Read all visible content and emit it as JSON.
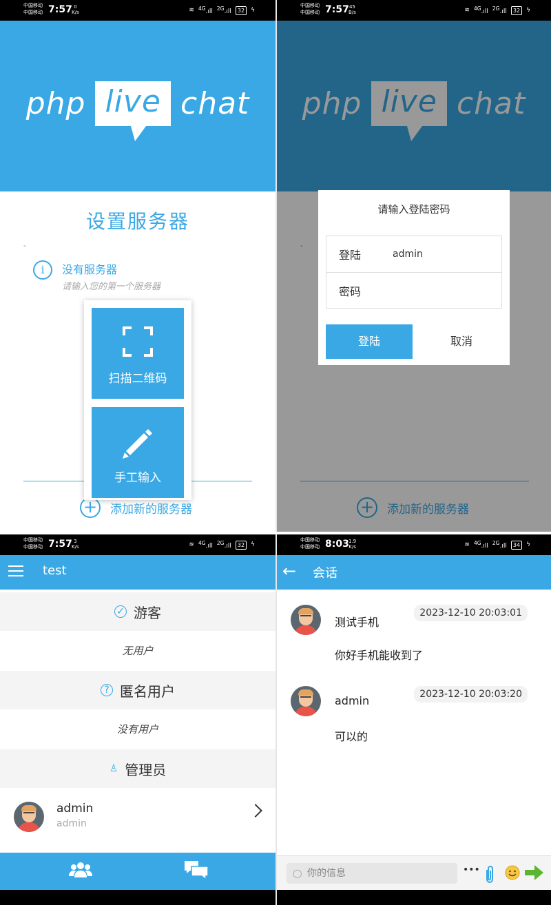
{
  "status_bars": [
    {
      "carrier1": "中国移动",
      "carrier2": "中国移动",
      "time": "7:57",
      "speed_num": "0",
      "speed_unit": "K/s",
      "net1": "4G",
      "net2": "2G",
      "battery": "32"
    },
    {
      "carrier1": "中国移动",
      "carrier2": "中国移动",
      "time": "7:57",
      "speed_num": "45",
      "speed_unit": "B/s",
      "net1": "4G",
      "net2": "2G",
      "battery": "32"
    },
    {
      "carrier1": "中国移动",
      "carrier2": "中国移动",
      "time": "7:57",
      "speed_num": "3",
      "speed_unit": "K/s",
      "net1": "4G",
      "net2": "2G",
      "battery": "32"
    },
    {
      "carrier1": "中国移动",
      "carrier2": "中国移动",
      "time": "8:03",
      "speed_num": "1.9",
      "speed_unit": "K/s",
      "net1": "4G",
      "net2": "2G",
      "battery": "34"
    }
  ],
  "logo": {
    "left": "php",
    "box": "live",
    "right": "chat"
  },
  "setup": {
    "title": "设置服务器",
    "dash": "-",
    "info_icon": "info-icon",
    "no_server": "没有服务器",
    "hint": "请输入您的第一个服务器",
    "add_server": "添加新的服务器"
  },
  "popup": {
    "scan_label": "扫描二维码",
    "manual_label": "手工输入",
    "scan_icon": "qr-scan-icon",
    "edit_icon": "pencil-icon"
  },
  "login_dialog": {
    "title": "请输入登陆密码",
    "login_label": "登陆",
    "login_value": "admin",
    "password_label": "密码",
    "login_button": "登陆",
    "cancel_button": "取消"
  },
  "users_screen": {
    "app_title": "test",
    "sections": [
      {
        "title": "游客",
        "empty": "无用户"
      },
      {
        "title": "匿名用户",
        "empty": "没有用户"
      },
      {
        "title": "管理员"
      }
    ],
    "admin_user": {
      "name": "admin",
      "sub": "admin"
    }
  },
  "chat_screen": {
    "title": "会话",
    "messages": [
      {
        "name": "测试手机",
        "time": "2023-12-10 20:03:01",
        "text": "你好手机能收到了"
      },
      {
        "name": "admin",
        "time": "2023-12-10 20:03:20",
        "text": "可以的"
      }
    ],
    "input_placeholder": "你的信息",
    "more": "•••"
  },
  "colors": {
    "primary": "#3aa8e4",
    "section_bg": "#f4f4f4",
    "send": "#5cb531"
  }
}
